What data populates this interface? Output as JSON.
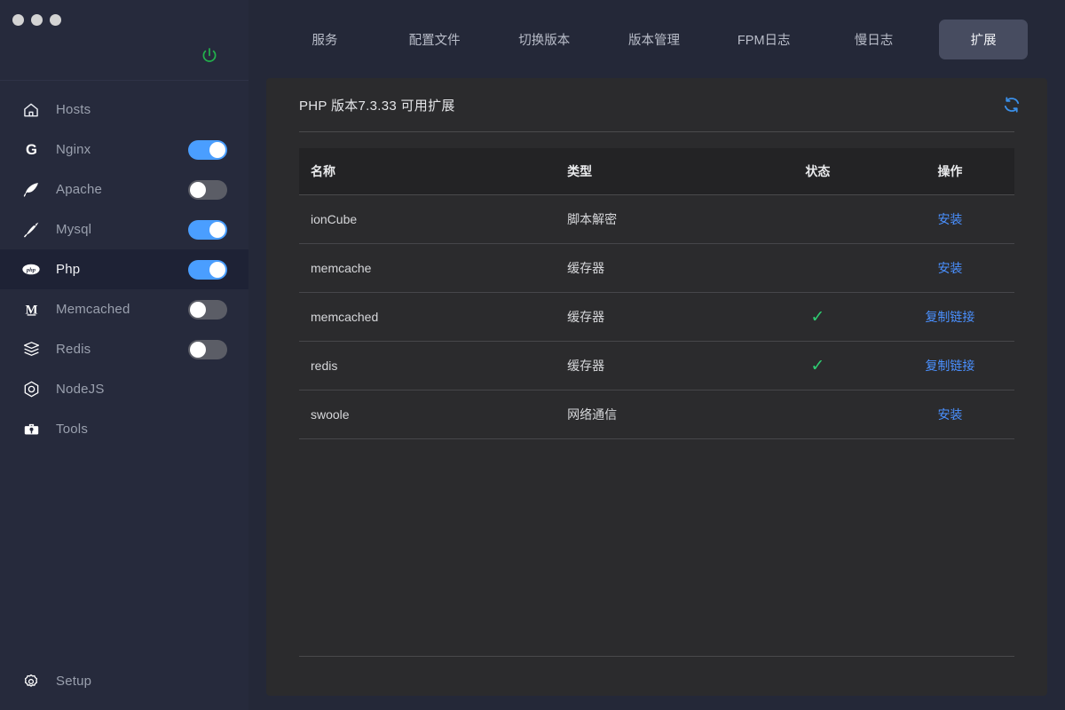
{
  "window": {
    "controls": [
      "minimize-dot",
      "maximize-dot",
      "close-dot"
    ]
  },
  "sidebar": {
    "power_icon": "power-icon",
    "power_color": "#22b14c",
    "items": [
      {
        "label": "Hosts",
        "icon": "home-icon",
        "has_toggle": false,
        "toggle_on": false,
        "active": false
      },
      {
        "label": "Nginx",
        "icon": "nginx-g-icon",
        "has_toggle": true,
        "toggle_on": true,
        "active": false
      },
      {
        "label": "Apache",
        "icon": "feather-icon",
        "has_toggle": true,
        "toggle_on": false,
        "active": false
      },
      {
        "label": "Mysql",
        "icon": "dolphin-icon",
        "has_toggle": true,
        "toggle_on": true,
        "active": false
      },
      {
        "label": "Php",
        "icon": "php-elephant-icon",
        "has_toggle": true,
        "toggle_on": true,
        "active": true
      },
      {
        "label": "Memcached",
        "icon": "memcached-m-icon",
        "has_toggle": true,
        "toggle_on": false,
        "active": false
      },
      {
        "label": "Redis",
        "icon": "redis-stack-icon",
        "has_toggle": true,
        "toggle_on": false,
        "active": false
      },
      {
        "label": "NodeJS",
        "icon": "nodejs-hex-icon",
        "has_toggle": false,
        "toggle_on": false,
        "active": false
      },
      {
        "label": "Tools",
        "icon": "toolbox-icon",
        "has_toggle": false,
        "toggle_on": false,
        "active": false
      }
    ],
    "bottom_item": {
      "label": "Setup",
      "icon": "gear-icon"
    }
  },
  "tabs": [
    {
      "label": "服务",
      "active": false
    },
    {
      "label": "配置文件",
      "active": false
    },
    {
      "label": "切换版本",
      "active": false
    },
    {
      "label": "版本管理",
      "active": false
    },
    {
      "label": "FPM日志",
      "active": false
    },
    {
      "label": "慢日志",
      "active": false
    },
    {
      "label": "扩展",
      "active": true
    }
  ],
  "card": {
    "title": "PHP 版本7.3.33 可用扩展",
    "refresh_icon": "refresh-icon",
    "refresh_color": "#3b8fe8"
  },
  "table": {
    "columns": [
      "名称",
      "类型",
      "状态",
      "操作"
    ],
    "rows": [
      {
        "name": "ionCube",
        "type": "脚本解密",
        "installed": false,
        "status": "",
        "action": "安装"
      },
      {
        "name": "memcache",
        "type": "缓存器",
        "installed": false,
        "status": "",
        "action": "安装"
      },
      {
        "name": "memcached",
        "type": "缓存器",
        "installed": true,
        "status": "✓",
        "action": "复制链接"
      },
      {
        "name": "redis",
        "type": "缓存器",
        "installed": true,
        "status": "✓",
        "action": "复制链接"
      },
      {
        "name": "swoole",
        "type": "网络通信",
        "installed": false,
        "status": "",
        "action": "安装"
      }
    ]
  },
  "colors": {
    "sidebar_bg": "#262a3c",
    "sidebar_active_bg": "#1e2235",
    "main_bg": "#242838",
    "card_bg": "#2b2b2d",
    "toggle_on": "#4a9eff",
    "toggle_off": "#5b5d66",
    "link": "#4a90ff",
    "check_green": "#2ecc71",
    "tab_active_bg": "#474c60"
  }
}
